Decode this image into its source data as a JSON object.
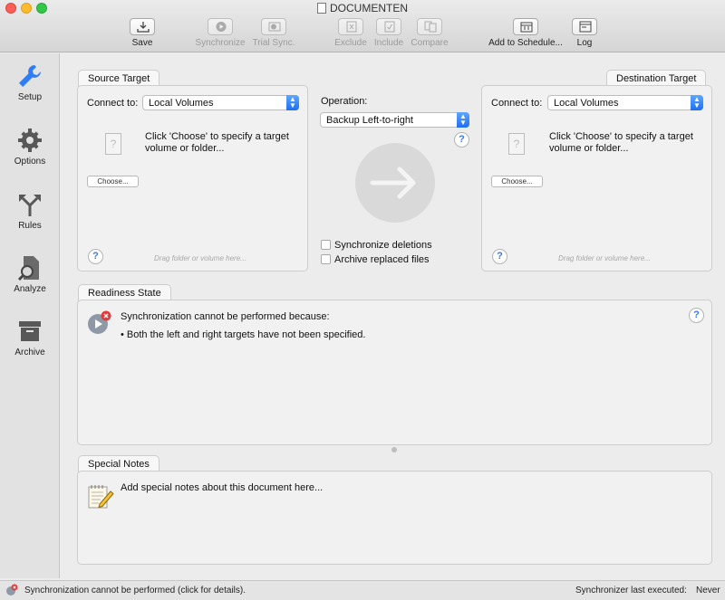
{
  "window": {
    "title": "DOCUMENTEN"
  },
  "toolbar": {
    "save": "Save",
    "synchronize": "Synchronize",
    "trial_sync": "Trial Sync.",
    "exclude": "Exclude",
    "include": "Include",
    "compare": "Compare",
    "add_to_schedule": "Add to Schedule...",
    "log": "Log"
  },
  "sidebar": {
    "items": [
      {
        "label": "Setup",
        "icon": "wrench-icon",
        "selected": true
      },
      {
        "label": "Options",
        "icon": "gear-icon"
      },
      {
        "label": "Rules",
        "icon": "fork-arrows-icon"
      },
      {
        "label": "Analyze",
        "icon": "magnifier-doc-icon"
      },
      {
        "label": "Archive",
        "icon": "archive-box-icon"
      }
    ]
  },
  "source": {
    "tab": "Source Target",
    "connect_label": "Connect to:",
    "connect_value": "Local Volumes",
    "instructions": "Click 'Choose' to specify a target volume or folder...",
    "choose": "Choose...",
    "hint": "Drag folder or volume here..."
  },
  "operation": {
    "label": "Operation:",
    "value": "Backup Left-to-right",
    "sync_deletions": "Synchronize deletions",
    "archive_replaced": "Archive replaced files"
  },
  "destination": {
    "tab": "Destination Target",
    "connect_label": "Connect to:",
    "connect_value": "Local Volumes",
    "instructions": "Click 'Choose' to specify a target volume or folder...",
    "choose": "Choose...",
    "hint": "Drag folder or volume here..."
  },
  "readiness": {
    "tab": "Readiness State",
    "message": "Synchronization cannot be performed because:",
    "reason": "• Both the left and right targets have not been specified."
  },
  "notes": {
    "tab": "Special Notes",
    "text": "Add special notes about this document here..."
  },
  "status": {
    "message": "Synchronization cannot be performed (click for details).",
    "last_label": "Synchronizer last executed:",
    "last_value": "Never"
  },
  "colors": {
    "accent": "#3478f6",
    "error": "#e23b3b"
  }
}
